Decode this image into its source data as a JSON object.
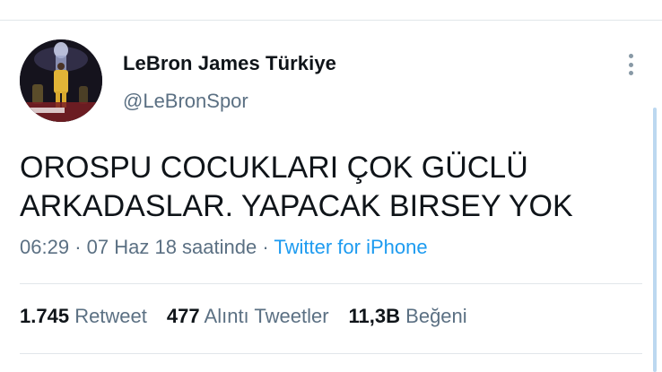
{
  "tweet": {
    "author": {
      "display_name": "LeBron James Türkiye",
      "handle": "@LeBronSpor",
      "avatar_icon": "profile-photo"
    },
    "text_lines": [
      "OROSPU COCUKLARI ÇOK GÜCLÜ",
      "ARKADASLAR. YAPACAK BIRSEY YOK"
    ],
    "time": "06:29",
    "date": "07 Haz 18 saatinde",
    "separator": "·",
    "source": "Twitter for iPhone",
    "stats": [
      {
        "count": "1.745",
        "label": "Retweet"
      },
      {
        "count": "477",
        "label": "Alıntı Tweetler"
      },
      {
        "count": "11,3B",
        "label": "Beğeni"
      }
    ]
  },
  "colors": {
    "text_primary": "#0f1419",
    "text_secondary": "#5b7083",
    "link": "#1d9bf0",
    "divider": "#e1e6ea"
  }
}
